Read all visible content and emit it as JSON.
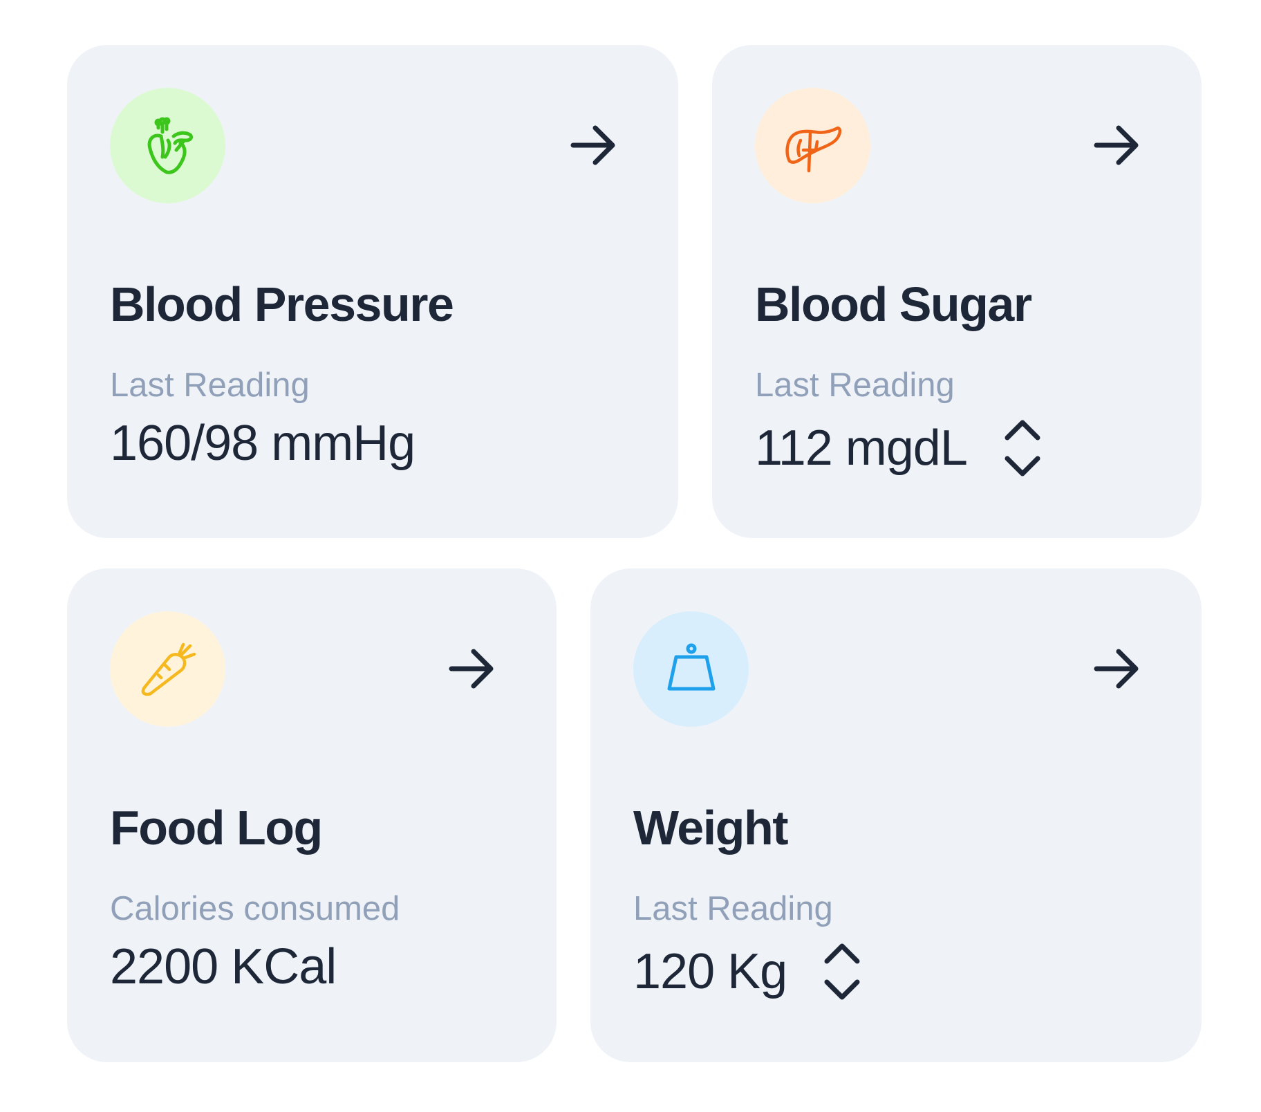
{
  "cards": [
    {
      "title": "Blood Pressure",
      "subtitle": "Last Reading",
      "value": "160/98 mmHg",
      "icon": "heart-icon",
      "icon_color": "#3cc61c",
      "icon_bg": "#dcfad2"
    },
    {
      "title": "Blood Sugar",
      "subtitle": "Last Reading",
      "value": "112 mgdL",
      "icon": "liver-icon",
      "icon_color": "#f06418",
      "icon_bg": "#ffeedb"
    },
    {
      "title": "Food Log",
      "subtitle": "Calories consumed",
      "value": "2200 KCal",
      "icon": "carrot-icon",
      "icon_color": "#f5b81e",
      "icon_bg": "#fff3dc"
    },
    {
      "title": "Weight",
      "subtitle": "Last Reading",
      "value": "120 Kg",
      "icon": "weight-icon",
      "icon_color": "#1ea0eb",
      "icon_bg": "#d8eefd"
    }
  ],
  "colors": {
    "card_bg": "#eff3f8",
    "title": "#1e2737",
    "subtitle": "#91a0b9"
  }
}
